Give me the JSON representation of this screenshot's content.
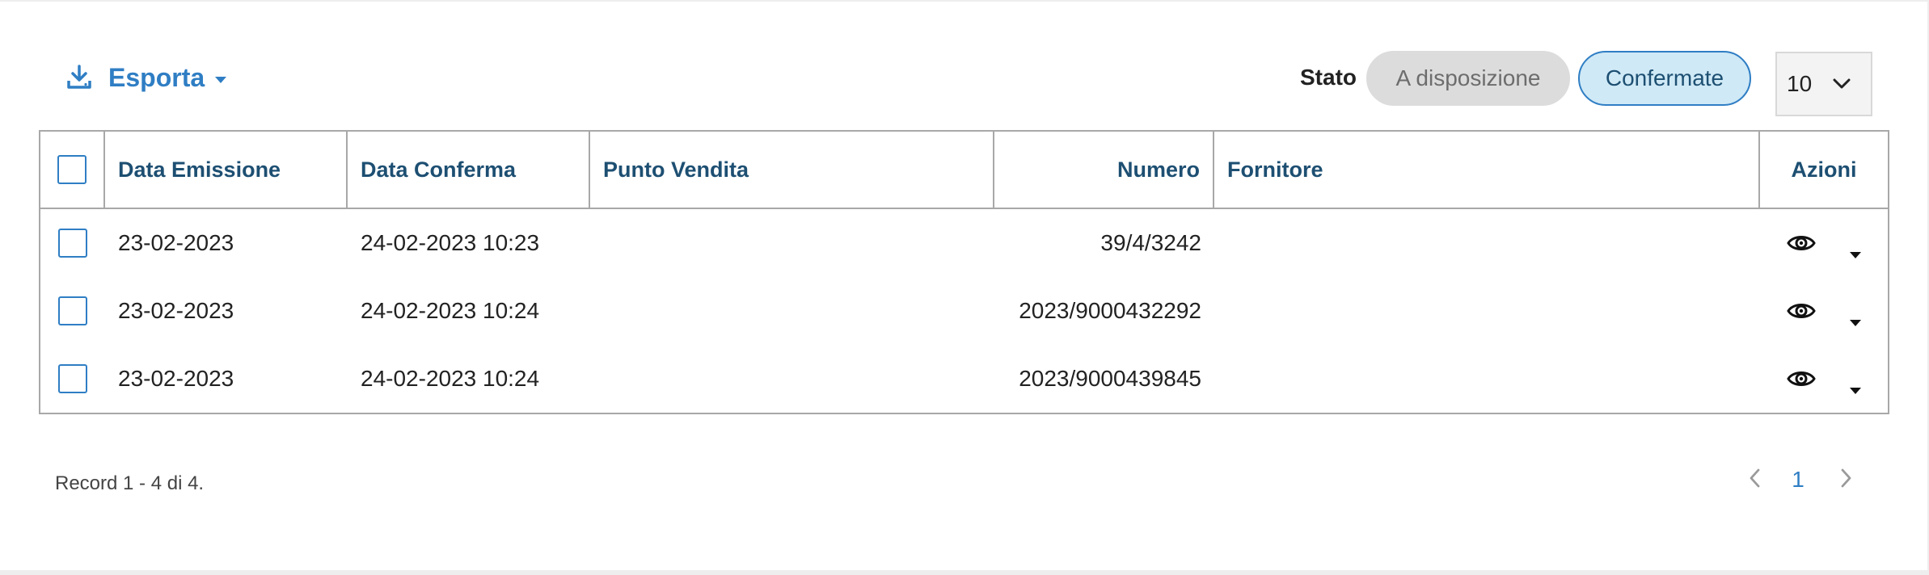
{
  "toolbar": {
    "export_label": "Esporta",
    "stato_label": "Stato",
    "filters": [
      {
        "label": "A disposizione",
        "active": false
      },
      {
        "label": "Confermate",
        "active": true
      }
    ],
    "page_size": "10"
  },
  "table": {
    "headers": {
      "data_emissione": "Data Emissione",
      "data_conferma": "Data Conferma",
      "punto_vendita": "Punto Vendita",
      "numero": "Numero",
      "fornitore": "Fornitore",
      "azioni": "Azioni"
    },
    "rows": [
      {
        "data_emissione": "23-02-2023",
        "data_conferma": "24-02-2023 10:23",
        "punto_vendita": "",
        "numero": "39/4/3242",
        "fornitore": ""
      },
      {
        "data_emissione": "23-02-2023",
        "data_conferma": "24-02-2023 10:24",
        "punto_vendita": "",
        "numero": "2023/9000432292",
        "fornitore": ""
      },
      {
        "data_emissione": "23-02-2023",
        "data_conferma": "24-02-2023 10:24",
        "punto_vendita": "",
        "numero": "2023/9000439845",
        "fornitore": ""
      }
    ]
  },
  "footer": {
    "record_info": "Record 1 - 4 di 4.",
    "current_page": "1"
  },
  "colors": {
    "accent": "#2f7ec4",
    "header_text": "#1d4f72",
    "active_pill_bg": "#cfe9f6",
    "inactive_pill_bg": "#dcdcdc"
  },
  "icons": {
    "export": "download-icon",
    "row_action": "eye-icon",
    "row_menu": "caret-down-icon"
  }
}
